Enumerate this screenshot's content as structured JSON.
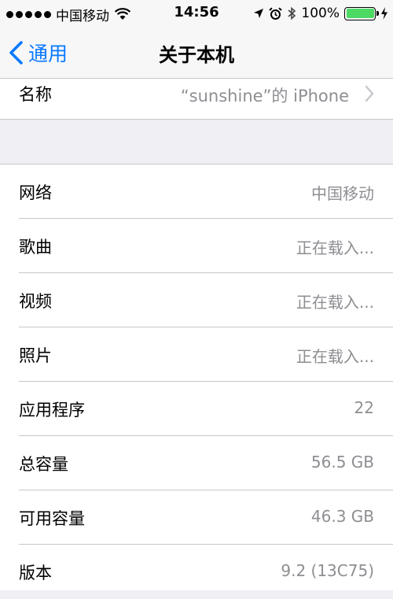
{
  "status_bar": {
    "carrier": "中国移动",
    "time": "14:56",
    "battery": "100%",
    "battery_level": 1.0
  },
  "nav": {
    "back_label": "通用",
    "title": "关于本机"
  },
  "name_row": {
    "label": "名称",
    "value": "“sunshine”的 iPhone"
  },
  "rows": [
    {
      "label": "网络",
      "value": "中国移动"
    },
    {
      "label": "歌曲",
      "value": "正在载入..."
    },
    {
      "label": "视频",
      "value": "正在载入..."
    },
    {
      "label": "照片",
      "value": "正在载入..."
    },
    {
      "label": "应用程序",
      "value": "22"
    },
    {
      "label": "总容量",
      "value": "56.5 GB"
    },
    {
      "label": "可用容量",
      "value": "46.3 GB"
    },
    {
      "label": "版本",
      "value": "9.2 (13C75)"
    }
  ],
  "colors": {
    "accent": "#0a7aff",
    "battery": "#4cd964",
    "secondary_text": "#8e8e93",
    "background": "#efeff4"
  },
  "icons": {
    "location": "location-arrow-icon",
    "alarm": "alarm-clock-icon",
    "bluetooth": "bluetooth-icon",
    "charging": "charging-bolt-icon",
    "back": "chevron-left-icon",
    "disclosure": "chevron-right-icon"
  }
}
